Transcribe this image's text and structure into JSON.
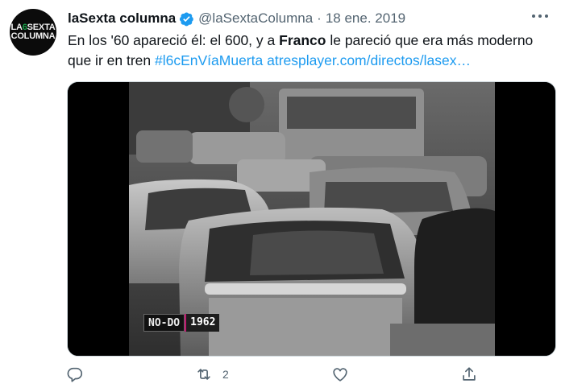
{
  "tweet": {
    "avatar": {
      "line1_pre": "LA",
      "line1_six": "6",
      "line1_post": "SEXTA",
      "line2": "COLUMNA"
    },
    "display_name": "laSexta columna",
    "handle": "@laSextaColumna",
    "separator": "·",
    "date": "18 ene. 2019",
    "text_part1": "En los '60 apareció él: el 600, y a ",
    "text_bold": "Franco",
    "text_part2": " le pareció que era más moderno que ir en tren ",
    "hashtag": "#l6cEnVíaMuerta",
    "link": "atresplayer.com/directos/lasex…",
    "media": {
      "badge_source": "NO-DO",
      "badge_year": "1962"
    },
    "actions": {
      "reply_count": "",
      "retweet_count": "2",
      "like_count": ""
    }
  },
  "colors": {
    "accent": "#1d9bf0",
    "secondary_text": "#536471",
    "verified": "#1d9bf0",
    "badge_stripe": "#c0186f"
  },
  "icons": [
    "avatar-logo",
    "verified-badge-icon",
    "more-icon",
    "reply-icon",
    "retweet-icon",
    "like-icon",
    "share-icon"
  ]
}
